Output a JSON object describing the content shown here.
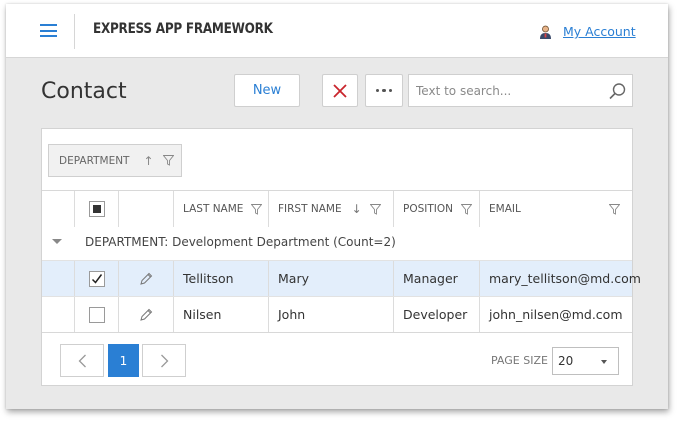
{
  "app": {
    "title": "EXPRESS APP FRAMEWORK",
    "account_label": "My Account"
  },
  "page": {
    "title": "Contact"
  },
  "toolbar": {
    "new_label": "New",
    "search_placeholder": "Text to search..."
  },
  "grouping": {
    "chip_label": "DEPARTMENT"
  },
  "grid": {
    "columns": {
      "last_name": "LAST NAME",
      "first_name": "FIRST NAME",
      "position": "POSITION",
      "email": "EMAIL"
    },
    "group_row": "DEPARTMENT: Development Department (Count=2)",
    "rows": [
      {
        "checked": true,
        "last_name": "Tellitson",
        "first_name": "Mary",
        "position": "Manager",
        "email": "mary_tellitson@md.com"
      },
      {
        "checked": false,
        "last_name": "Nilsen",
        "first_name": "John",
        "position": "Developer",
        "email": "john_nilsen@md.com"
      }
    ]
  },
  "pager": {
    "current_page": "1",
    "page_size_label": "PAGE SIZE",
    "page_size_value": "20"
  },
  "colors": {
    "accent": "#2a7fd4",
    "delete_x": "#c9252c",
    "selected_row": "#e3eefb",
    "background": "#e9e9e9"
  },
  "icons": [
    "hamburger-menu-icon",
    "account-icon",
    "close-x-icon",
    "more-icon",
    "search-icon",
    "sort-up-icon",
    "sort-down-icon",
    "filter-icon",
    "checkmark-icon",
    "pencil-icon",
    "chevron-left-icon",
    "chevron-right-icon",
    "dropdown-arrow-icon"
  ]
}
